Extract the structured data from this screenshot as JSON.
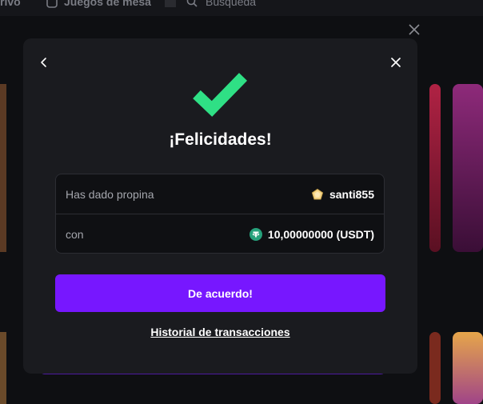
{
  "background": {
    "topbar_items": [
      {
        "label": "rivo",
        "icon": "live-icon"
      },
      {
        "label": "Juegos de mesa",
        "icon": "dice-icon"
      },
      {
        "label": "Búsqueda",
        "icon": "search-icon"
      }
    ]
  },
  "modal": {
    "title": "¡Felicidades!",
    "success_icon": "checkmark-icon",
    "accent_color": "#2fe085",
    "rows": [
      {
        "label": "Has dado propina",
        "value": "santi855",
        "icon": "vip-badge-icon"
      },
      {
        "label": "con",
        "value": "10,00000000 (USDT)",
        "icon": "tether-icon"
      }
    ],
    "confirm_label": "De acuerdo!",
    "confirm_color": "#7717ff",
    "history_link": "Historial de transacciones"
  }
}
